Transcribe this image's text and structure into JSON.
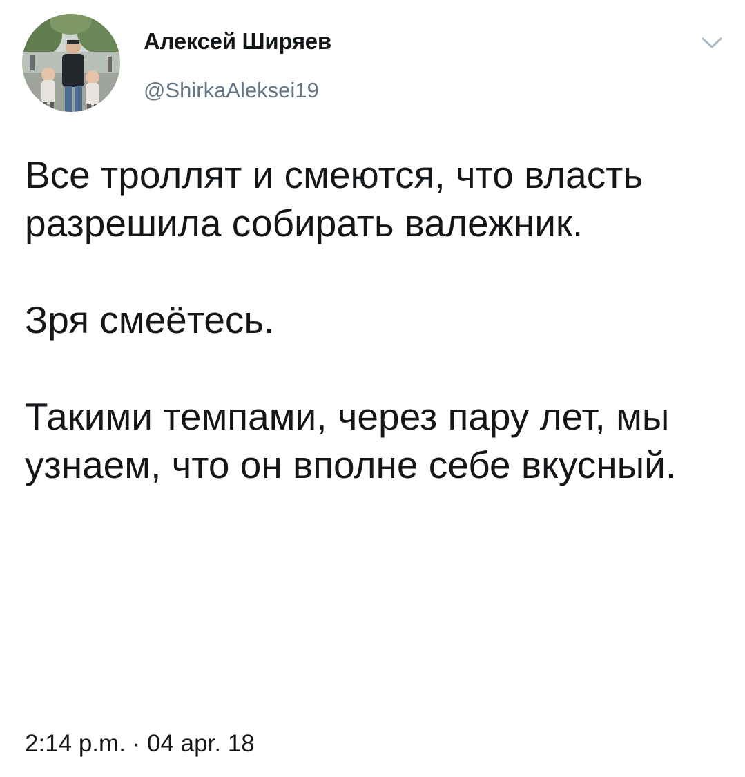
{
  "author": {
    "display_name": "Алексей Ширяев",
    "handle": "@ShirkaAleksei19",
    "avatar_icon": "profile-photo"
  },
  "menu_icon": "chevron-down-icon",
  "tweet": {
    "paragraphs": [
      "Все троллят и смеются, что власть разрешила собирать валежник.",
      "Зря смеётесь.",
      "Такими темпами, через пару лет, мы узнаем, что он вполне себе вкусный."
    ],
    "timestamp": "2:14 p.m. · 04 apr. 18"
  },
  "colors": {
    "text": "#14171a",
    "secondary_text": "#657786",
    "chevron": "#aab8c2",
    "background": "#ffffff"
  }
}
